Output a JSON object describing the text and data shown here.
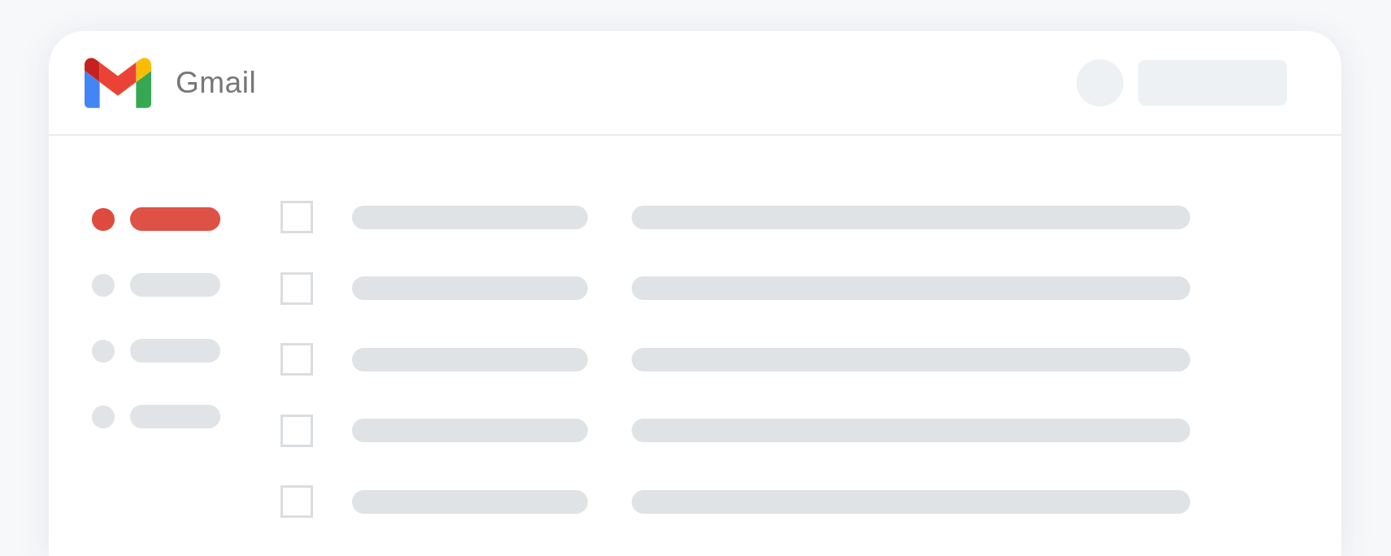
{
  "app": {
    "title": "Gmail"
  },
  "sidebar": {
    "items": [
      {
        "selected": true
      },
      {
        "selected": false
      },
      {
        "selected": false
      },
      {
        "selected": false
      }
    ]
  },
  "messages": {
    "rows": [
      {
        "checked": false
      },
      {
        "checked": false
      },
      {
        "checked": false
      },
      {
        "checked": false
      },
      {
        "checked": false
      }
    ]
  }
}
